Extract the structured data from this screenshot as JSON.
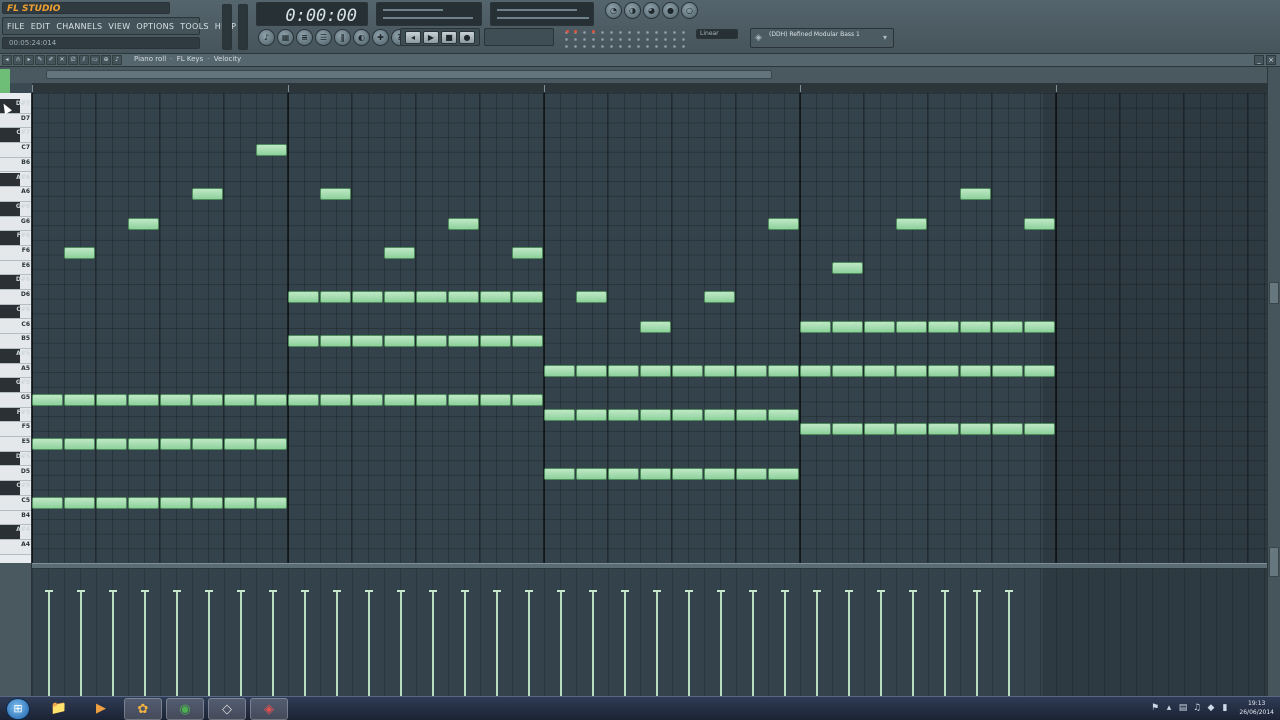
{
  "app": {
    "logo": "FL STUDIO"
  },
  "menu": [
    "FILE",
    "EDIT",
    "CHANNELS",
    "VIEW",
    "OPTIONS",
    "TOOLS",
    "HELP"
  ],
  "hint_bar": "00:05:24:014",
  "transport": {
    "time": "0:00:00",
    "play_icon": "play-icon",
    "stop_icon": "stop-icon",
    "record_icon": "record-icon"
  },
  "tempo_readout": "Linear",
  "plugin": {
    "name": "(DDH) Refined Modular Bass 1"
  },
  "piano_roll": {
    "title": "Piano roll",
    "instrument": "FL Keys",
    "target": "Velocity"
  },
  "keys": [
    {
      "label": "D#7",
      "black": true
    },
    {
      "label": "D7",
      "black": false
    },
    {
      "label": "C#7",
      "black": true
    },
    {
      "label": "C7",
      "black": false
    },
    {
      "label": "B6",
      "black": false
    },
    {
      "label": "A#6",
      "black": true
    },
    {
      "label": "A6",
      "black": false
    },
    {
      "label": "G#6",
      "black": true
    },
    {
      "label": "G6",
      "black": false
    },
    {
      "label": "F#6",
      "black": true
    },
    {
      "label": "F6",
      "black": false
    },
    {
      "label": "E6",
      "black": false
    },
    {
      "label": "D#6",
      "black": true
    },
    {
      "label": "D6",
      "black": false
    },
    {
      "label": "C#6",
      "black": true
    },
    {
      "label": "C6",
      "black": false
    },
    {
      "label": "B5",
      "black": false
    },
    {
      "label": "A#5",
      "black": true
    },
    {
      "label": "A5",
      "black": false
    },
    {
      "label": "G#5",
      "black": true
    },
    {
      "label": "G5",
      "black": false
    },
    {
      "label": "F#5",
      "black": true
    },
    {
      "label": "F5",
      "black": false
    },
    {
      "label": "E5",
      "black": false
    },
    {
      "label": "D#5",
      "black": true
    },
    {
      "label": "D5",
      "black": false
    },
    {
      "label": "C#5",
      "black": true
    },
    {
      "label": "C5",
      "black": false
    },
    {
      "label": "B4",
      "black": false
    },
    {
      "label": "A#4",
      "black": true
    },
    {
      "label": "A4",
      "black": false
    }
  ],
  "notes": [
    {
      "pitch": "F6",
      "start": 0.5,
      "len": 0.5
    },
    {
      "pitch": "G6",
      "start": 1.5,
      "len": 0.5
    },
    {
      "pitch": "A6",
      "start": 2.5,
      "len": 0.5
    },
    {
      "pitch": "C7",
      "start": 3.5,
      "len": 0.5
    },
    {
      "pitch": "A6",
      "start": 4.5,
      "len": 0.5
    },
    {
      "pitch": "F6",
      "start": 5.5,
      "len": 0.5
    },
    {
      "pitch": "G6",
      "start": 6.5,
      "len": 0.5
    },
    {
      "pitch": "F6",
      "start": 7.5,
      "len": 0.5
    },
    {
      "pitch": "D6",
      "start": 8.5,
      "len": 0.5
    },
    {
      "pitch": "C6",
      "start": 9.5,
      "len": 0.5
    },
    {
      "pitch": "D6",
      "start": 10.5,
      "len": 0.5
    },
    {
      "pitch": "G6",
      "start": 11.5,
      "len": 0.5
    },
    {
      "pitch": "E6",
      "start": 12.5,
      "len": 0.5
    },
    {
      "pitch": "G6",
      "start": 13.5,
      "len": 0.5
    },
    {
      "pitch": "A6",
      "start": 14.5,
      "len": 0.5
    },
    {
      "pitch": "G6",
      "start": 15.5,
      "len": 0.5
    },
    {
      "pitch": "G5",
      "start": 0,
      "len": 8,
      "step": 0.5
    },
    {
      "pitch": "E5",
      "start": 0,
      "len": 4,
      "step": 0.5
    },
    {
      "pitch": "C5",
      "start": 0,
      "len": 4,
      "step": 0.5
    },
    {
      "pitch": "D6",
      "start": 4,
      "len": 4,
      "step": 0.5
    },
    {
      "pitch": "B5",
      "start": 4,
      "len": 4,
      "step": 0.5
    },
    {
      "pitch": "A5",
      "start": 8,
      "len": 8,
      "step": 0.5
    },
    {
      "pitch": "F#5",
      "start": 8,
      "len": 4,
      "step": 0.5
    },
    {
      "pitch": "D5",
      "start": 8,
      "len": 4,
      "step": 0.5
    },
    {
      "pitch": "C6",
      "start": 12,
      "len": 4,
      "step": 0.5
    },
    {
      "pitch": "F5",
      "start": 12,
      "len": 4,
      "step": 0.5
    }
  ],
  "velocity": {
    "count": 31,
    "level": 0.8
  },
  "taskbar": {
    "apps": [
      "file-explorer-icon",
      "media-player-icon",
      "fl-studio-icon",
      "chrome-icon",
      "app-icon-1",
      "app-icon-2"
    ],
    "time": "19:13",
    "date": "26/06/2014"
  }
}
